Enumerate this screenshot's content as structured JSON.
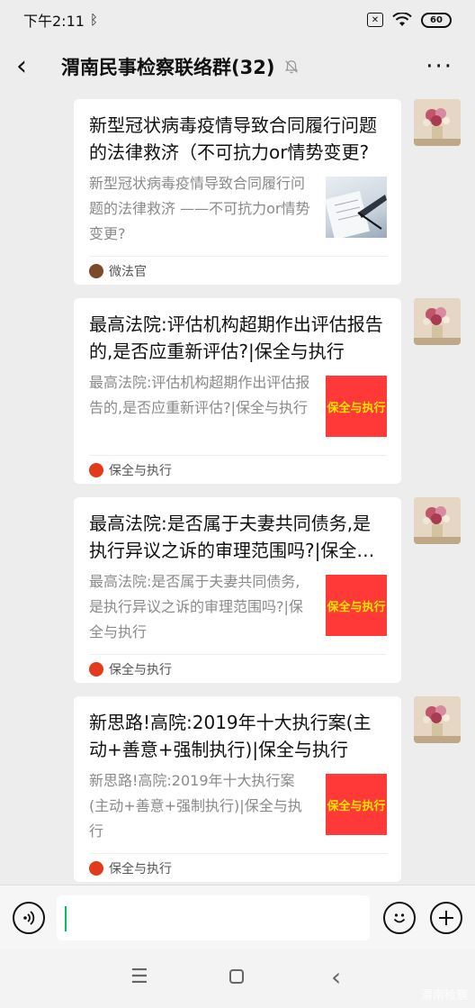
{
  "status_bar": {
    "time": "下午2:11",
    "battery": "60"
  },
  "header": {
    "title": "渭南民事检察联络群(32)"
  },
  "messages": [
    {
      "title": "新型冠状病毒疫情导致合同履行问题的法律救济（不可抗力or情势变更?",
      "desc": "新型冠状病毒疫情导致合同履行问题的法律救济 ——不可抗力or情势变更?",
      "source": "微法官",
      "thumb_type": "photo"
    },
    {
      "title": "最高法院:评估机构超期作出评估报告的,是否应重新评估?|保全与执行",
      "desc": "最高法院:评估机构超期作出评估报告的,是否应重新评估?|保全与执行",
      "source": "保全与执行",
      "thumb_text": "保全与执行",
      "thumb_type": "brand"
    },
    {
      "title": "最高法院:是否属于夫妻共同债务,是执行异议之诉的审理范围吗?|保全与执行",
      "desc": "最高法院:是否属于夫妻共同债务,是执行异议之诉的审理范围吗?|保全与执行",
      "source": "保全与执行",
      "thumb_text": "保全与执行",
      "thumb_type": "brand"
    },
    {
      "title": "新思路!高院:2019年十大执行案(主动+善意+强制执行)|保全与执行",
      "desc": "新思路!高院:2019年十大执行案(主动+善意+强制执行)|保全与执行",
      "source": "保全与执行",
      "thumb_text": "保全与执行",
      "thumb_type": "brand"
    }
  ],
  "watermark": "渭南检察",
  "colors": {
    "brand_red": "#ff3838",
    "brand_yellow": "#ffe600",
    "cursor_green": "#07c160"
  }
}
